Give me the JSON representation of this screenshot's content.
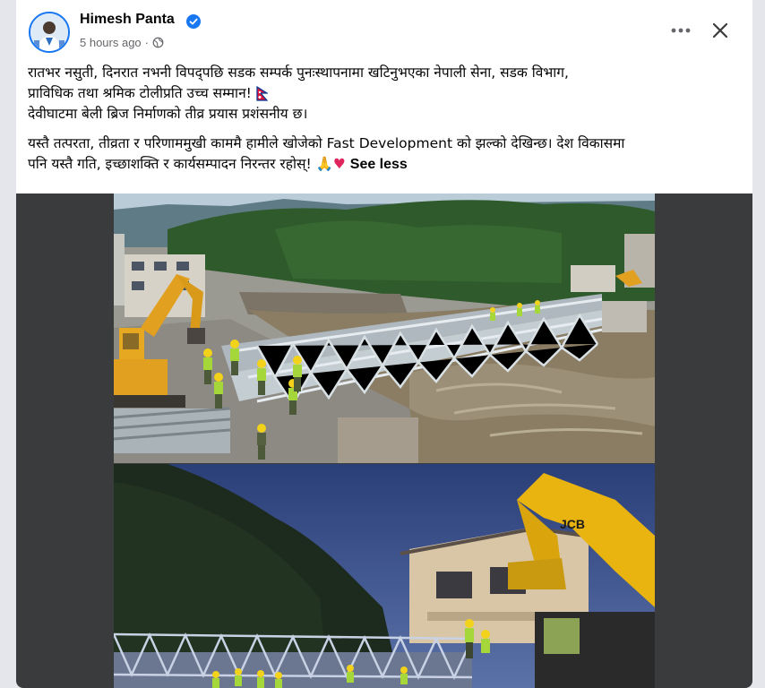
{
  "post": {
    "author": "Himesh Panta",
    "timestamp": "5 hours ago",
    "separator": "·",
    "verified": true,
    "line1": "रातभर नसुती, दिनरात नभनी विपद्पछि सडक सम्पर्क पुनःस्थापनामा खटिनुभएका नेपाली सेना, सडक विभाग,",
    "line2": "प्राविधिक तथा श्रमिक टोलीप्रति उच्च सम्मान!",
    "line3": "देवीघाटमा बेली ब्रिज निर्माणको तीव्र प्रयास प्रशंसनीय छ।",
    "line4": "यस्तै तत्परता, तीव्रता र परिणाममुखी काममै हामीले खोजेको Fast Development को झल्को देखिन्छ। देश विकासमा",
    "line5": "पनि यस्तै गति, इच्छाशक्ति र कार्यसम्पादन निरन्तर रहोस्!",
    "emoji_pray": "🙏",
    "emoji_heart": "♥",
    "see_less": "See less",
    "photo_text_jcb": "JCB"
  },
  "icons": {
    "more": "more-horizontal-icon",
    "close": "close-icon",
    "privacy": "globe-icon",
    "verified": "verified-badge-icon",
    "flag": "nepal-flag-icon"
  },
  "colors": {
    "verified_blue": "#1877f2",
    "meta_gray": "#65676b",
    "heart_red": "#e0245e",
    "media_bg": "#3a3b3c"
  }
}
